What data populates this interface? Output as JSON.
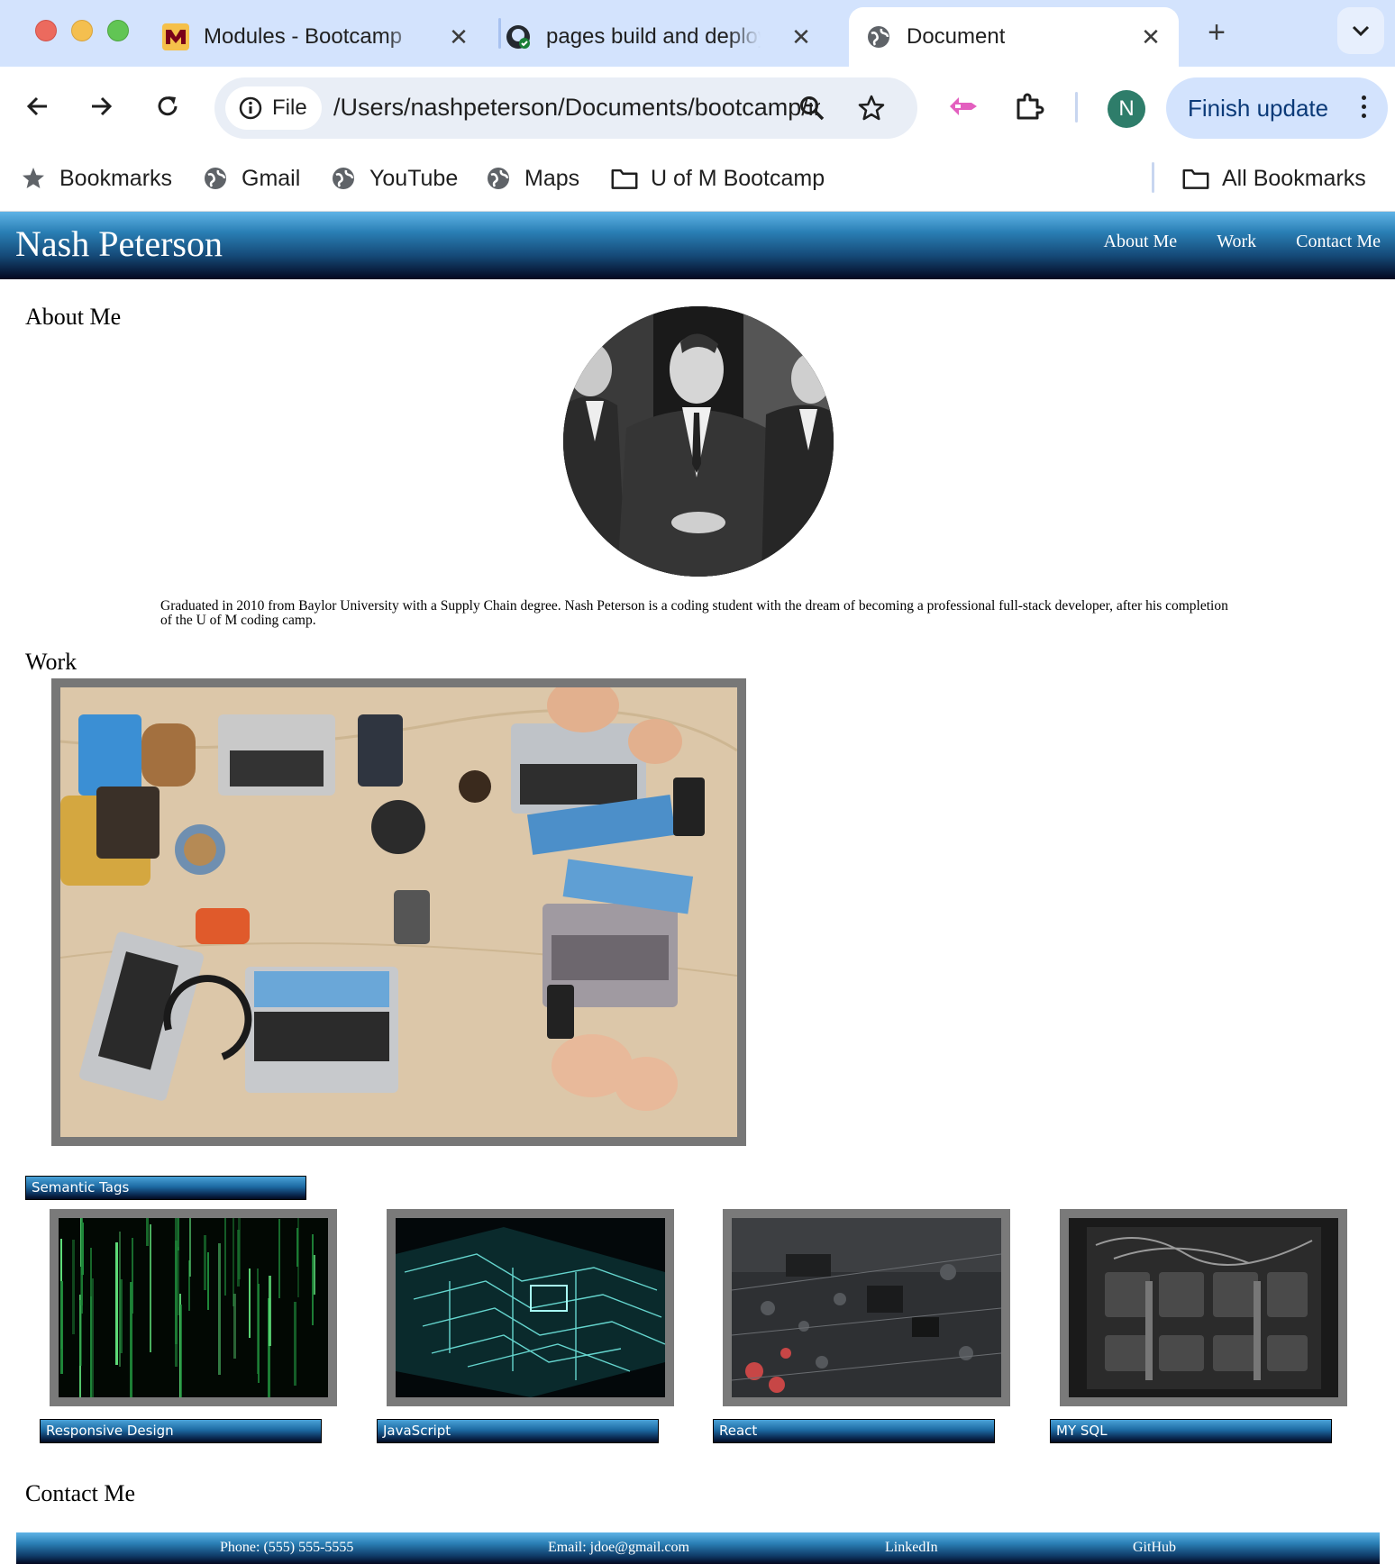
{
  "browser": {
    "tabs": [
      {
        "title": "Modules - Bootcamp",
        "favicon": "university-m-icon",
        "active": false
      },
      {
        "title": "pages build and deploy",
        "favicon": "github-icon",
        "active": false
      },
      {
        "title": "Document",
        "favicon": "globe-icon",
        "active": true
      }
    ],
    "omnibox": {
      "chip_label": "File",
      "url": "/Users/nashpeterson/Documents/bootcamp/index.html"
    },
    "profile_initial": "N",
    "finish_update_label": "Finish update",
    "bookmarks": [
      {
        "label": "Bookmarks",
        "icon": "star-icon"
      },
      {
        "label": "Gmail",
        "icon": "globe-icon"
      },
      {
        "label": "YouTube",
        "icon": "globe-icon"
      },
      {
        "label": "Maps",
        "icon": "globe-icon"
      },
      {
        "label": "U of M Bootcamp",
        "icon": "folder-icon"
      }
    ],
    "all_bookmarks_label": "All Bookmarks"
  },
  "site": {
    "title": "Nash Peterson",
    "nav": [
      "About Me",
      "Work",
      "Contact Me"
    ],
    "about": {
      "heading": "About Me",
      "text": "Graduated in 2010 from Baylor University with a Supply Chain degree. Nash Peterson is a coding student with the dream of becoming a professional full-stack developer, after his completion of the U of M coding camp."
    },
    "work": {
      "heading": "Work",
      "featured_label": "Semantic Tags",
      "projects": [
        {
          "label": "Responsive Design"
        },
        {
          "label": "JavaScript"
        },
        {
          "label": "React"
        },
        {
          "label": "MY SQL"
        }
      ]
    },
    "contact": {
      "heading": "Contact Me",
      "phone": "Phone: (555) 555-5555",
      "email": "Email: jdoe@gmail.com",
      "linkedin": "LinkedIn",
      "github": "GitHub"
    }
  },
  "colors": {
    "tabstrip": "#d3e3fd",
    "header_gradient_top": "#5fb3e6",
    "header_gradient_bottom": "#03071f",
    "frame_gray": "#777777"
  }
}
